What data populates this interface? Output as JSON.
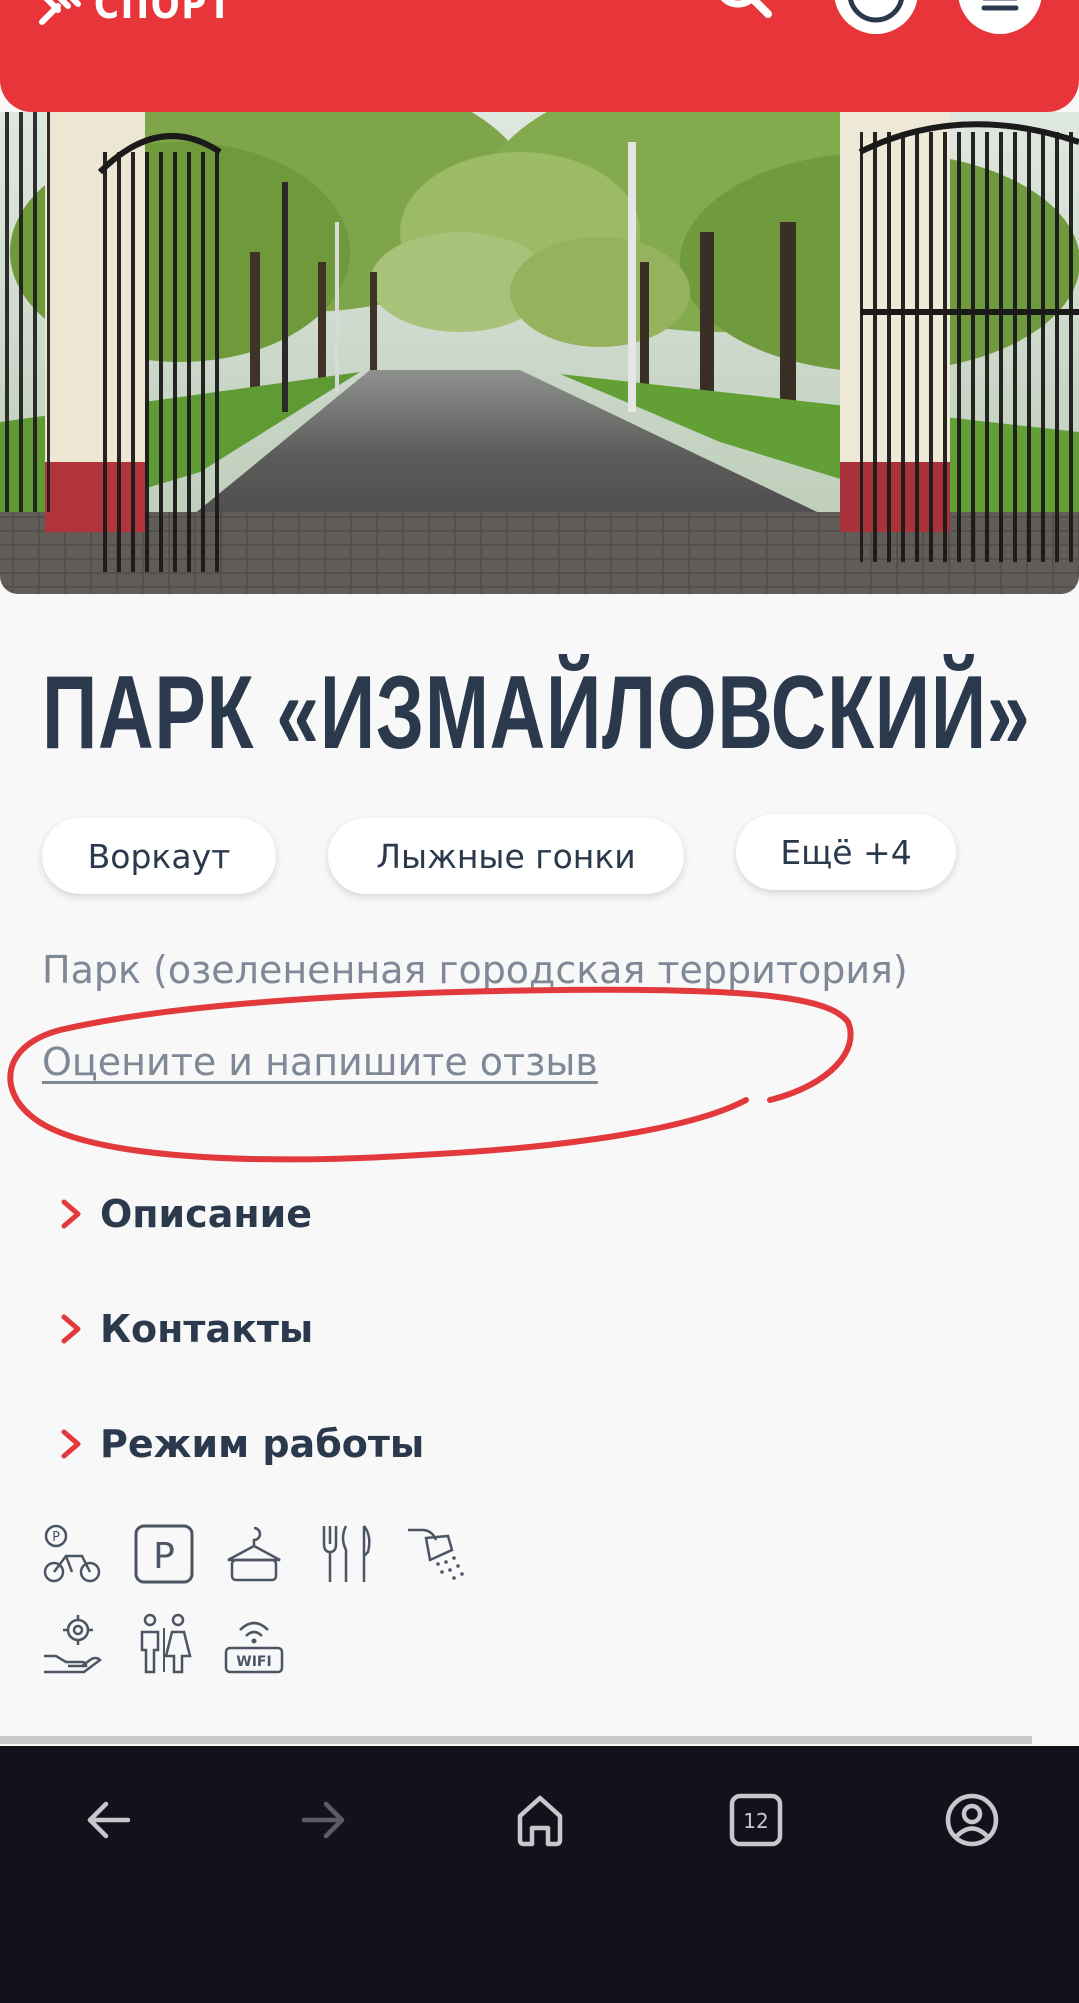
{
  "header": {
    "logo_text": "СПОРТ",
    "search_icon": "search-icon",
    "profile_icon": "user-icon",
    "menu_icon": "menu-icon",
    "background": "#e8353a"
  },
  "hero": {
    "image": "park-entrance-photo"
  },
  "place": {
    "title": "ПАРК «ИЗМАЙЛОВСКИЙ»",
    "tags": [
      "Воркаут",
      "Лыжные гонки",
      "Ещё +4"
    ],
    "category": "Парк (озелененная городская территория)",
    "review_link": "Оцените и напишите отзыв"
  },
  "accordion": [
    {
      "label": "Описание"
    },
    {
      "label": "Контакты"
    },
    {
      "label": "Режим работы"
    }
  ],
  "amenities": [
    "bike-parking-icon",
    "parking-icon",
    "cloakroom-icon",
    "food-icon",
    "shower-icon",
    "rental-service-icon",
    "toilet-icon",
    "wifi-icon"
  ],
  "amenity_labels": {
    "parking": "P",
    "wifi": "WIFI"
  },
  "browser_nav": {
    "tab_count": "12",
    "buttons": [
      "back-icon",
      "forward-icon",
      "home-icon",
      "tabs-icon",
      "account-icon"
    ]
  },
  "colors": {
    "accent": "#e8353a",
    "title": "#2b394d",
    "muted": "#7f8896",
    "nav_bg": "#12121d"
  }
}
